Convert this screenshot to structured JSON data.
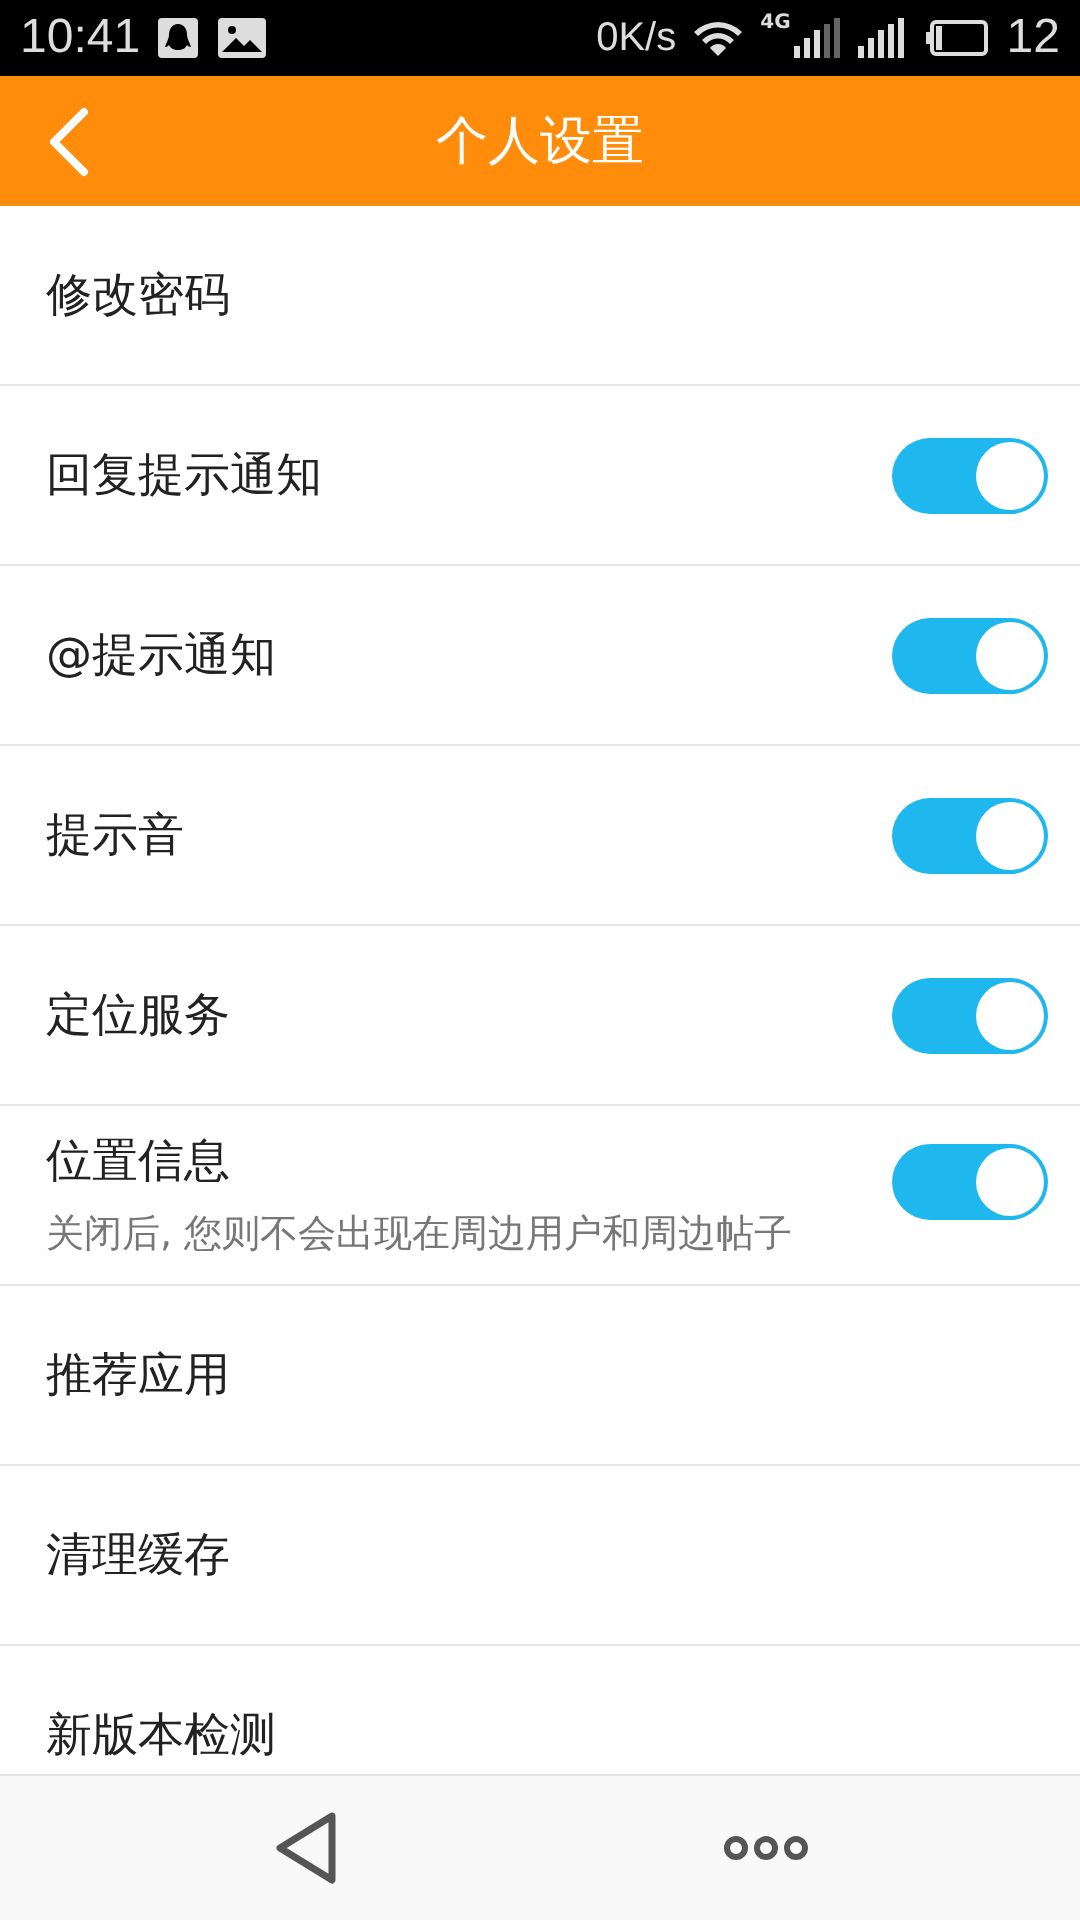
{
  "status_bar": {
    "time": "10:41",
    "speed": "0K/s",
    "network": "4G",
    "battery": "12"
  },
  "header": {
    "title": "个人设置"
  },
  "items": [
    {
      "kind": "plain",
      "label": "修改密码"
    },
    {
      "kind": "toggle",
      "label": "回复提示通知",
      "on": true
    },
    {
      "kind": "toggle",
      "label": "@提示通知",
      "on": true
    },
    {
      "kind": "toggle",
      "label": "提示音",
      "on": true
    },
    {
      "kind": "toggle",
      "label": "定位服务",
      "on": true
    },
    {
      "kind": "toggle",
      "label": "位置信息",
      "on": true,
      "subtitle": "关闭后, 您则不会出现在周边用户和周边帖子"
    },
    {
      "kind": "plain",
      "label": "推荐应用"
    },
    {
      "kind": "plain",
      "label": "清理缓存"
    },
    {
      "kind": "plain",
      "label": "新版本检测"
    }
  ]
}
